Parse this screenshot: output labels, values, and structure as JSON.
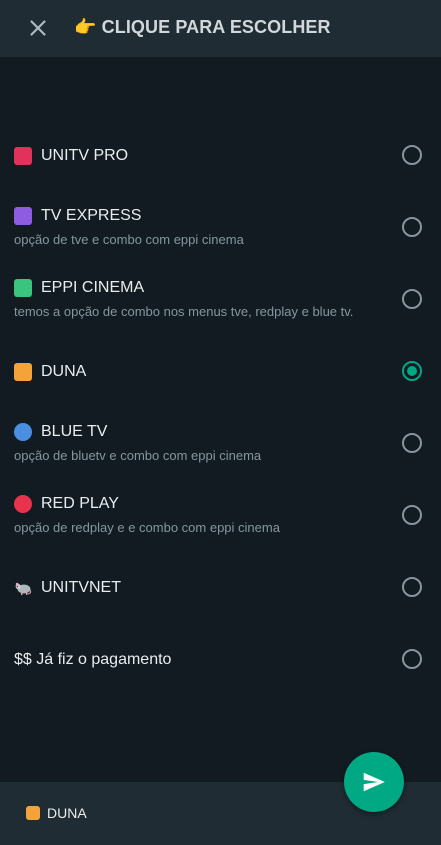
{
  "header": {
    "close_icon": "close-icon",
    "title_emoji": "👉",
    "title": "CLIQUE PARA ESCOLHER"
  },
  "options": [
    {
      "emoji": "red-square",
      "color": "#e0325b",
      "label": "UNITV PRO",
      "description": "",
      "selected": false
    },
    {
      "emoji": "purple-square",
      "color": "#8e5ce0",
      "label": "TV EXPRESS",
      "description": "opção de tve e combo com eppi cinema",
      "selected": false
    },
    {
      "emoji": "green-square",
      "color": "#3bc47d",
      "label": "EPPI CINEMA",
      "description": "temos a opção de combo nos menus tve, redplay e blue tv.",
      "selected": false
    },
    {
      "emoji": "orange-square",
      "color": "#f4a23a",
      "label": "DUNA",
      "description": "",
      "selected": true
    },
    {
      "emoji": "blue-circle",
      "color": "#4a8fe0",
      "label": "BLUE TV",
      "description": "opção de bluetv e combo com eppi cinema",
      "selected": false
    },
    {
      "emoji": "red-circle",
      "color": "#e8334f",
      "label": "RED PLAY",
      "description": "opção de redplay e e combo com eppi cinema",
      "selected": false
    },
    {
      "emoji": "rat",
      "color": "#b0b6bd",
      "label": "UNITVNET",
      "description": "",
      "selected": false
    },
    {
      "emoji": "",
      "color": "",
      "label": "$$ Já fiz o pagamento",
      "description": "",
      "selected": false
    }
  ],
  "footer": {
    "selected_emoji": "orange-square",
    "selected_label": "DUNA",
    "send_icon": "send-icon"
  },
  "colors": {
    "background": "#111b21",
    "panel": "#202c33",
    "accent": "#00a884",
    "muted": "#8696a0"
  }
}
